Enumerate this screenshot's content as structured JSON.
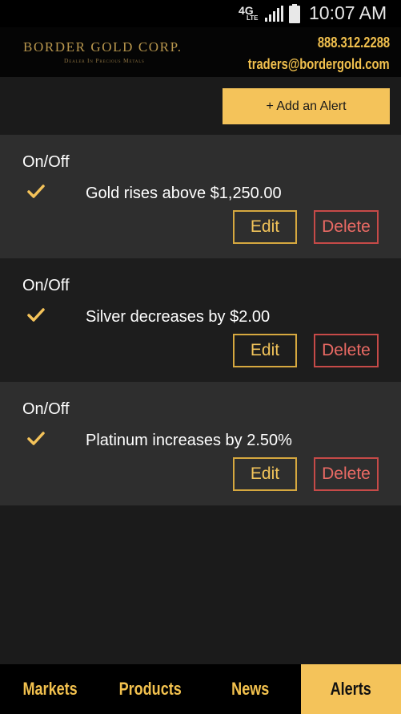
{
  "status_bar": {
    "network_top": "4G",
    "network_bottom": "LTE",
    "time": "10:07 AM"
  },
  "header": {
    "brand_name": "BORDER GOLD CORP.",
    "tagline": "Dealer In Precious Metals",
    "phone": "888.312.2288",
    "email": "traders@bordergold.com"
  },
  "toolbar": {
    "add_alert_label": "+ Add an Alert"
  },
  "alerts": [
    {
      "toggle_label": "On/Off",
      "enabled": true,
      "text": "Gold rises above $1,250.00",
      "edit_label": "Edit",
      "delete_label": "Delete"
    },
    {
      "toggle_label": "On/Off",
      "enabled": true,
      "text": "Silver decreases by $2.00",
      "edit_label": "Edit",
      "delete_label": "Delete"
    },
    {
      "toggle_label": "On/Off",
      "enabled": true,
      "text": "Platinum increases by 2.50%",
      "edit_label": "Edit",
      "delete_label": "Delete"
    }
  ],
  "nav": {
    "tabs": [
      "Markets",
      "Products",
      "News",
      "Alerts"
    ],
    "active": "Alerts"
  },
  "colors": {
    "accent_gold": "#f4c35a",
    "delete_red": "#ea6a64",
    "card_light": "#2e2e2e",
    "card_dark": "#1d1d1d"
  },
  "icons": [
    "signal-icon",
    "battery-icon",
    "check-icon"
  ]
}
